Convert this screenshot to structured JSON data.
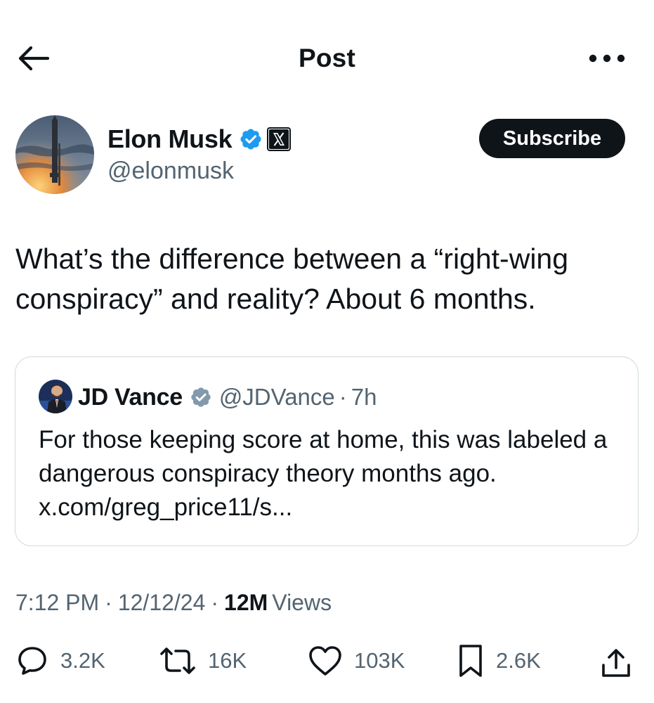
{
  "header": {
    "title": "Post",
    "back_icon": "arrow-left-icon",
    "more_icon": "more-horizontal-icon"
  },
  "author": {
    "name": "Elon Musk",
    "handle": "@elonmusk",
    "verified_icon": "verified-badge-icon",
    "affiliate_icon": "x-logo-icon",
    "subscribe_label": "Subscribe"
  },
  "post": {
    "text": "What’s the difference between a “right-wing conspiracy” and reality? About 6 months."
  },
  "quote": {
    "name": "JD Vance",
    "handle": "@JDVance",
    "separator": "·",
    "time": "7h",
    "text": "For those keeping score at home, this was labeled a dangerous conspiracy theory months ago. x.com/greg_price11/s..."
  },
  "meta": {
    "time": "7:12 PM",
    "separator": "·",
    "date": "12/12/24",
    "views_count": "12M",
    "views_label": "Views"
  },
  "actions": {
    "replies": "3.2K",
    "reposts": "16K",
    "likes": "103K",
    "bookmarks": "2.6K"
  },
  "colors": {
    "text": "#0f1419",
    "secondary": "#536471",
    "verified_blue": "#1d9bf0",
    "quote_badge_gray": "#829aab",
    "border": "#cfd9de"
  }
}
